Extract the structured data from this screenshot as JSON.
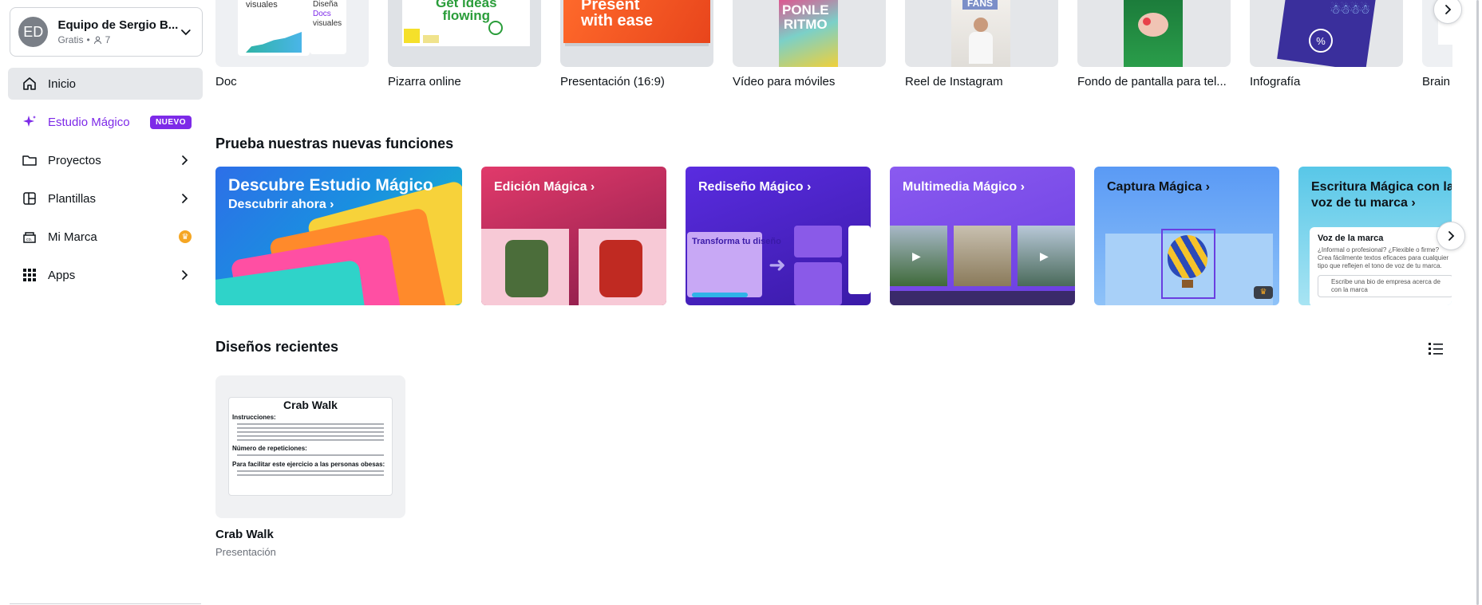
{
  "team": {
    "initials": "ED",
    "name": "Equipo de Sergio B...",
    "plan": "Gratis",
    "members": "7"
  },
  "nav": {
    "home": "Inicio",
    "magic_studio": "Estudio Mágico",
    "new_badge": "NUEVO",
    "projects": "Proyectos",
    "templates": "Plantillas",
    "brand": "Mi Marca",
    "apps": "Apps"
  },
  "templates": {
    "items": [
      {
        "label": "Doc",
        "thumb_text": "visuales · Diseña Docs visuales"
      },
      {
        "label": "Pizarra online",
        "thumb_text": "Get ideas flowing"
      },
      {
        "label": "Presentación (16:9)",
        "thumb_text": "Present with ease"
      },
      {
        "label": "Vídeo para móviles",
        "thumb_text": "PONLE RITMO"
      },
      {
        "label": "Reel de Instagram",
        "thumb_text": "FANS"
      },
      {
        "label": "Fondo de pantalla para tel...",
        "thumb_text": ""
      },
      {
        "label": "Infografía",
        "thumb_text": "%"
      },
      {
        "label": "Brain",
        "thumb_text": ""
      }
    ]
  },
  "features": {
    "heading": "Prueba nuestras nuevas funciones",
    "discover_title": "Descubre Estudio Mágico",
    "discover_cta": "Descubrir ahora ›",
    "edit": "Edición Mágica ›",
    "redesign": "Rediseño Mágico ›",
    "redesign_inner": "Transforma tu diseño",
    "multimedia": "Multimedia Mágico ›",
    "capture": "Captura Mágica ›",
    "writing": "Escritura Mágica con la voz de tu marca ›",
    "writing_panel_title": "Voz de la marca",
    "writing_panel_body": "¿Informal o profesional? ¿Flexible o firme? Crea fácilmente textos eficaces para cualquier tipo que reflejen el tono de voz de tu marca.",
    "writing_input": "Escribe una bio de empresa acerca de con la marca"
  },
  "recent": {
    "heading": "Diseños recientes",
    "design_title": "Crab Walk",
    "design_type": "Presentación",
    "doc_title": "Crab Walk",
    "doc_h1": "Instrucciones:",
    "doc_h2": "Número de repeticiones:",
    "doc_h3": "Para facilitar este ejercicio a las personas obesas:"
  },
  "colors": {
    "accent": "#7d2ae8",
    "active_bg": "#e6e8eb"
  }
}
